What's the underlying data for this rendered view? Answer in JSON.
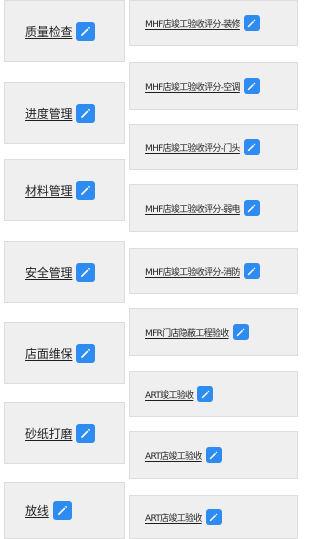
{
  "accent_color": "#2e8cf0",
  "icons": {
    "edit": "edit-icon"
  },
  "left_items": [
    {
      "label": "质量检查"
    },
    {
      "label": "进度管理"
    },
    {
      "label": "材料管理"
    },
    {
      "label": "安全管理"
    },
    {
      "label": "店面维保"
    },
    {
      "label": "砂纸打磨"
    },
    {
      "label": "放线"
    }
  ],
  "right_items": [
    {
      "label": "MHF店竣工验收评分-装修"
    },
    {
      "label": "MHF店竣工验收评分-空调"
    },
    {
      "label": "MHF店竣工验收评分-门头"
    },
    {
      "label": "MHF店竣工验收评分-弱电"
    },
    {
      "label": "MHF店竣工验收评分-消防"
    },
    {
      "label": "MFR门店隐蔽工程验收"
    },
    {
      "label": "ART竣工验收"
    },
    {
      "label": "ART店竣工验收"
    },
    {
      "label": "ART店竣工验收"
    }
  ]
}
